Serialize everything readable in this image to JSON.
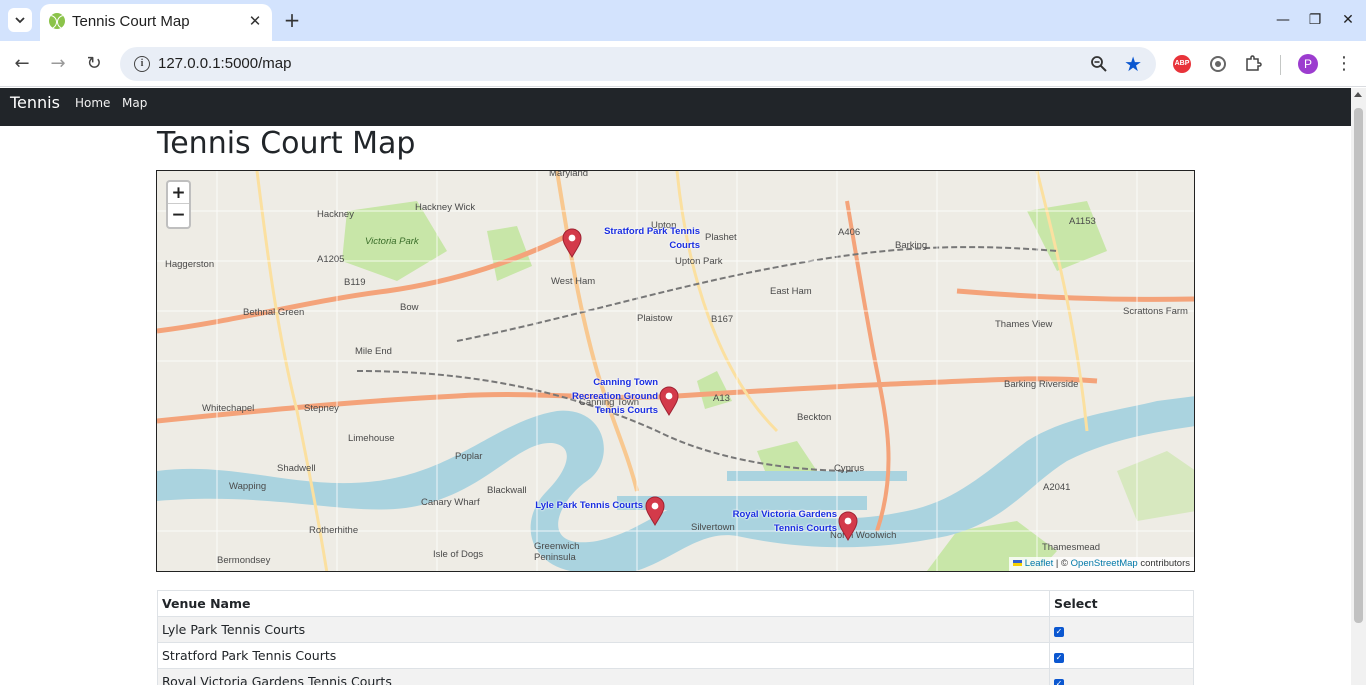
{
  "browser": {
    "tab_title": "Tennis Court Map",
    "url": "127.0.0.1:5000/map",
    "profile_initial": "P",
    "abp_label": "ABP",
    "icons": [
      "tab-search-icon",
      "tennis-ball-favicon-icon",
      "close-icon",
      "new-tab-icon",
      "minimize-icon",
      "restore-icon",
      "window-close-icon",
      "back-icon",
      "forward-icon",
      "reload-icon",
      "site-info-icon",
      "zoom-icon",
      "bookmark-star-icon",
      "adblock-icon",
      "record-icon",
      "extensions-icon",
      "kebab-menu-icon"
    ],
    "accent_color": "#0b57d0"
  },
  "navbar": {
    "brand": "Tennis",
    "links": [
      "Home",
      "Map"
    ]
  },
  "page": {
    "title": "Tennis Court Map"
  },
  "map": {
    "zoom_in": "+",
    "zoom_out": "−",
    "markers": [
      {
        "label_lines": [
          "Stratford Park Tennis",
          "Courts"
        ]
      },
      {
        "label_lines": [
          "Canning Town",
          "Recreation Ground",
          "Tennis Courts"
        ]
      },
      {
        "label_lines": [
          "Lyle Park Tennis Courts"
        ]
      },
      {
        "label_lines": [
          "Royal Victoria Gardens",
          "Tennis Courts"
        ]
      }
    ],
    "place_names": [
      "Maryland",
      "Hackney",
      "Hackney Wick",
      "Haggerston",
      "Bethnal Green",
      "Bow",
      "Mile End",
      "Whitechapel",
      "Stepney",
      "Limehouse",
      "Shadwell",
      "Wapping",
      "Rotherhithe",
      "Bermondsey",
      "Poplar",
      "Blackwall",
      "Canary Wharf",
      "Isle of Dogs",
      "Greenwich Peninsula",
      "West Ham",
      "Upton Park",
      "Plashet",
      "Plaistow",
      "East Ham",
      "Canning Town",
      "Silvertown",
      "North Woolwich",
      "Beckton",
      "Cyprus",
      "Barking",
      "Thames View",
      "Barking Riverside",
      "Thamesmead",
      "Scrattons Farm",
      "Victoria Park",
      "Upton"
    ],
    "road_labels": [
      "A1205",
      "B119",
      "B167",
      "A13",
      "A406",
      "A1153",
      "A2041"
    ],
    "attribution": {
      "leaflet": "Leaflet",
      "sep": " | © ",
      "osm": "OpenStreetMap",
      "suffix": " contributors"
    },
    "colors": {
      "land": "#eeece5",
      "water": "#aad3df",
      "park": "#c8e6a8",
      "major_road": "#f4a37a",
      "marker": "#d33a4a",
      "label": "#1a2ee0"
    }
  },
  "table": {
    "headers": [
      "Venue Name",
      "Select"
    ],
    "rows": [
      {
        "name": "Lyle Park Tennis Courts",
        "selected": true
      },
      {
        "name": "Stratford Park Tennis Courts",
        "selected": true
      },
      {
        "name": "Royal Victoria Gardens Tennis Courts",
        "selected": true
      }
    ]
  }
}
